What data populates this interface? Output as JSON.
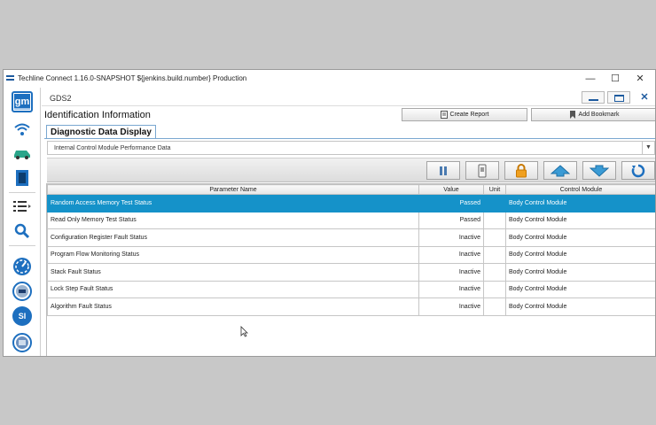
{
  "window": {
    "title": "Techline Connect 1.16.0-SNAPSHOT ${jenkins.build.number} Production",
    "minimize": "—",
    "maximize": "☐",
    "close": "✕"
  },
  "sidebar": {
    "logo": "gm",
    "items": [
      {
        "icon": "gm-logo-icon"
      },
      {
        "icon": "wifi-icon"
      },
      {
        "icon": "vehicle-icon"
      },
      {
        "icon": "module-icon"
      },
      {
        "icon": "list-menu-icon"
      },
      {
        "icon": "search-icon"
      },
      {
        "icon": "gauge-icon"
      },
      {
        "icon": "gds-icon"
      },
      {
        "icon": "si-icon",
        "label": "SI"
      },
      {
        "icon": "tool-icon"
      }
    ]
  },
  "app": {
    "title": "GDS2",
    "page_title": "Identification Information",
    "create_report": "Create Report",
    "add_bookmark": "Add Bookmark",
    "tab": "Diagnostic Data Display",
    "dropdown_value": "Internal Control Module Performance Data"
  },
  "toolbar": [
    "pause-icon",
    "record-icon",
    "lock-icon",
    "arrow-up-icon",
    "arrow-down-icon",
    "refresh-icon"
  ],
  "table": {
    "headers": [
      "Parameter Name",
      "Value",
      "Unit",
      "Control Module"
    ],
    "rows": [
      {
        "name": "Random Access Memory Test Status",
        "value": "Passed",
        "unit": "",
        "module": "Body Control Module",
        "selected": true
      },
      {
        "name": "Read Only Memory Test Status",
        "value": "Passed",
        "unit": "",
        "module": "Body Control Module"
      },
      {
        "name": "Configuration Register Fault Status",
        "value": "Inactive",
        "unit": "",
        "module": "Body Control Module"
      },
      {
        "name": "Program Flow Monitoring Status",
        "value": "Inactive",
        "unit": "",
        "module": "Body Control Module"
      },
      {
        "name": "Stack Fault Status",
        "value": "Inactive",
        "unit": "",
        "module": "Body Control Module"
      },
      {
        "name": "Lock Step Fault Status",
        "value": "Inactive",
        "unit": "",
        "module": "Body Control Module"
      },
      {
        "name": "Algorithm Fault Status",
        "value": "Inactive",
        "unit": "",
        "module": "Body Control Module"
      }
    ]
  },
  "colors": {
    "selected_row": "#1592c9",
    "gm_blue": "#1d6fbf",
    "arrow_blue": "#3a9bd5",
    "lock_orange": "#f0a020"
  }
}
